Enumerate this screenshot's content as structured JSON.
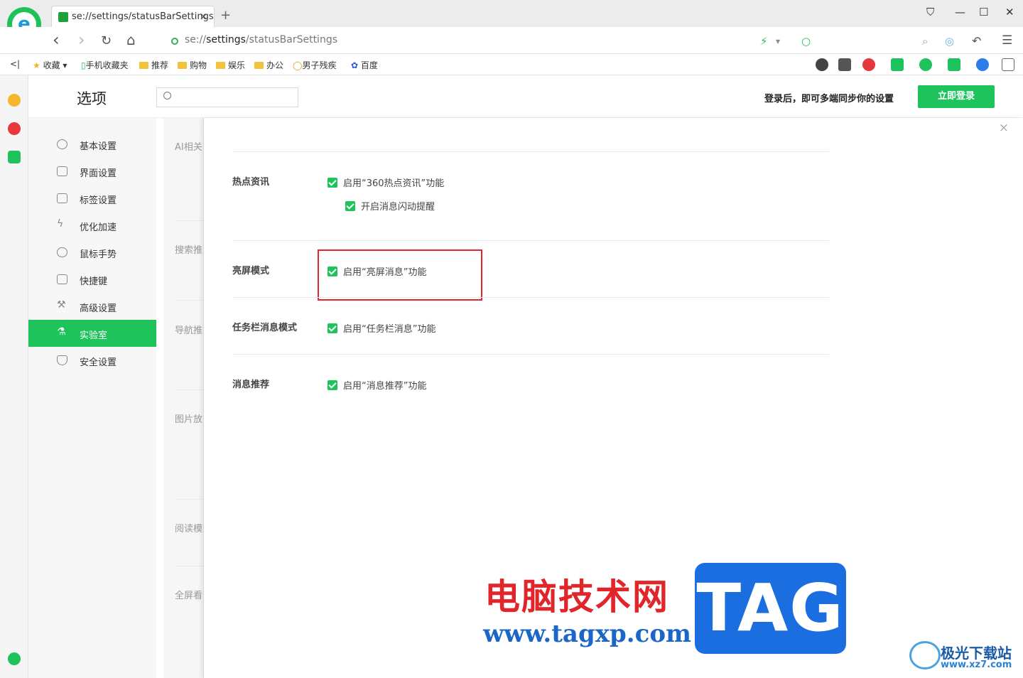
{
  "tab": {
    "title": "se://settings/statusBarSettings",
    "close": "×"
  },
  "newtab": "+",
  "window": {
    "min": "—",
    "max": "☐",
    "close": "✕",
    "skin": "👕"
  },
  "nav": {
    "back": "‹",
    "forward": "›",
    "reload": "↻",
    "home": "⌂",
    "url_prefix": "se://",
    "url_bold": "settings",
    "url_suffix": "/statusBarSettings"
  },
  "bookmarks": {
    "collapse": "<|",
    "items": [
      "收藏",
      "手机收藏夹",
      "推荐",
      "购物",
      "娱乐",
      "办公",
      "男子残疾",
      "百度"
    ]
  },
  "header": {
    "title": "选项",
    "search_placeholder": "",
    "login_hint": "登录后，即可多端同步你的设置",
    "login_button": "立即登录"
  },
  "menu": {
    "items": [
      {
        "label": "基本设置"
      },
      {
        "label": "界面设置"
      },
      {
        "label": "标签设置"
      },
      {
        "label": "优化加速"
      },
      {
        "label": "鼠标手势"
      },
      {
        "label": "快捷键"
      },
      {
        "label": "高级设置"
      },
      {
        "label": "实验室",
        "active": true
      },
      {
        "label": "安全设置"
      }
    ]
  },
  "midcol": [
    "AI相关",
    "搜索推",
    "导航推",
    "图片放",
    "阅读模",
    "全屏看"
  ],
  "panel": {
    "close": "×",
    "sections": [
      {
        "title": "热点资讯",
        "options": [
          "启用“360热点资讯”功能",
          "开启消息闪动提醒"
        ]
      },
      {
        "title": "亮屏模式",
        "options": [
          "启用“亮屏消息”功能"
        ]
      },
      {
        "title": "任务栏消息模式",
        "options": [
          "启用“任务栏消息”功能"
        ]
      },
      {
        "title": "消息推荐",
        "options": [
          "启用“消息推荐”功能"
        ]
      }
    ]
  },
  "watermark": {
    "cn": "电脑技术网",
    "url": "www.tagxp.com",
    "tag": "TAG",
    "site_cn": "极光下载站",
    "site_url": "www.xz7.com"
  },
  "colors": {
    "accent": "#1fc35c",
    "highlight": "#e8242b"
  }
}
